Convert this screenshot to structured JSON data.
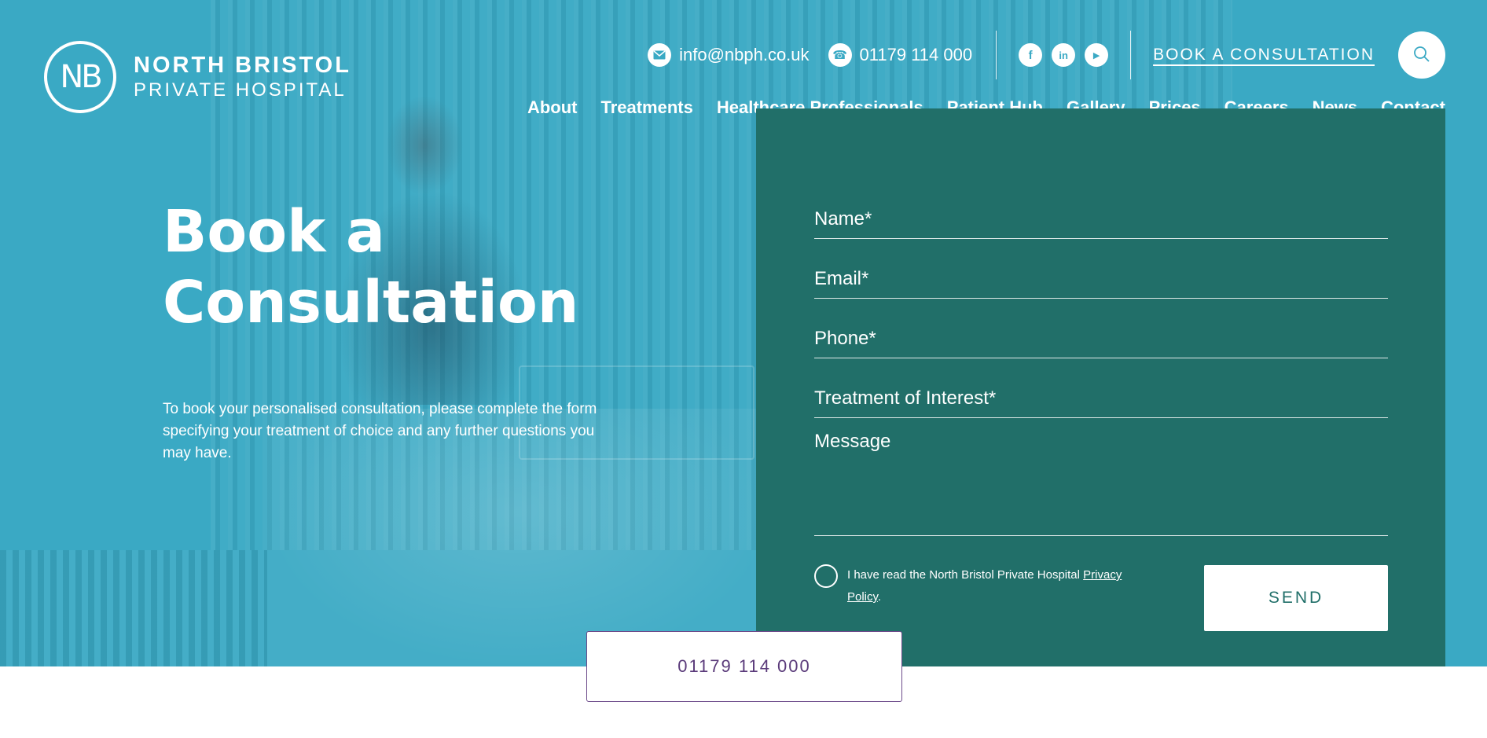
{
  "logo": {
    "mark": "NB",
    "line1": "NORTH BRISTOL",
    "line2": "PRIVATE HOSPITAL"
  },
  "topbar": {
    "email": "info@nbph.co.uk",
    "phone": "01179 114 000",
    "social": [
      {
        "name": "facebook-icon",
        "glyph": "f"
      },
      {
        "name": "linkedin-icon",
        "glyph": "in"
      },
      {
        "name": "youtube-icon",
        "glyph": "▶"
      }
    ],
    "book_label": "BOOK A CONSULTATION"
  },
  "nav": [
    "About",
    "Treatments",
    "Healthcare Professionals",
    "Patient Hub",
    "Gallery",
    "Prices",
    "Careers",
    "News",
    "Contact"
  ],
  "hero": {
    "title_line1": "Book a",
    "title_line2": "Consultation",
    "intro": "To book your personalised consultation, please complete the form specifying your treatment of choice and any further questions you may have."
  },
  "form": {
    "name_placeholder": "Name*",
    "email_placeholder": "Email*",
    "phone_placeholder": "Phone*",
    "treatment_placeholder": "Treatment of Interest*",
    "message_placeholder": "Message",
    "consent_prefix": "I have read the North Bristol Private Hospital ",
    "consent_link": "Privacy Policy",
    "consent_suffix": ".",
    "send_label": "SEND"
  },
  "footer_phone": "01179 114 000",
  "colors": {
    "hero_bg": "#3aa9c4",
    "form_bg": "#216f69",
    "phone_accent": "#5a3a7a"
  }
}
